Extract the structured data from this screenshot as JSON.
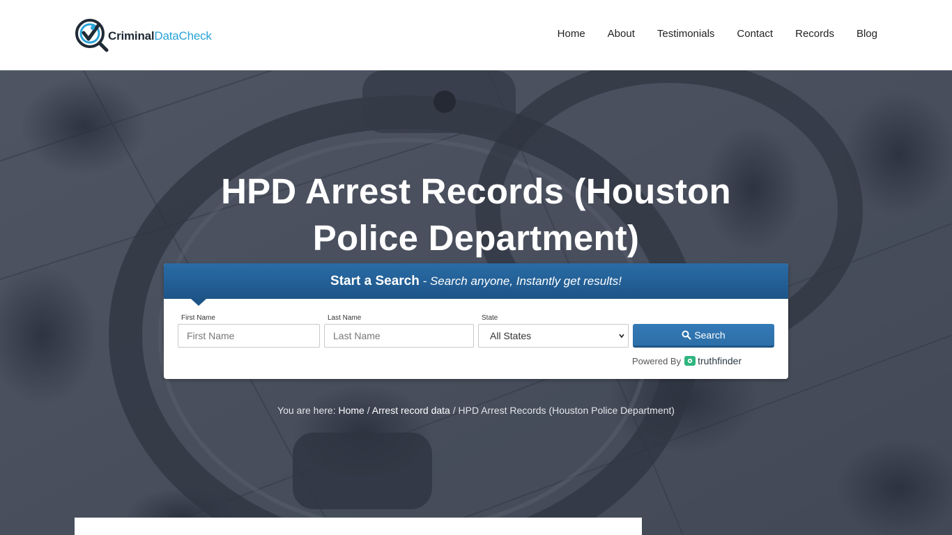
{
  "header": {
    "logo": {
      "bold": "Criminal",
      "light": "DataCheck"
    },
    "nav": [
      "Home",
      "About",
      "Testimonials",
      "Contact",
      "Records",
      "Blog"
    ]
  },
  "hero": {
    "title": "HPD Arrest Records (Houston Police Department)"
  },
  "search_widget": {
    "heading_strong": "Start a Search",
    "heading_em": " - Search anyone, Instantly get results!",
    "first_name": {
      "label": "First Name",
      "placeholder": "First Name"
    },
    "last_name": {
      "label": "Last Name",
      "placeholder": "Last Name"
    },
    "state": {
      "label": "State",
      "selected": "All States"
    },
    "button_label": "Search",
    "powered_by": "Powered By",
    "provider": "truthfinder"
  },
  "breadcrumb": {
    "prefix": "You are here:",
    "items": [
      "Home",
      "Arrest record data",
      "HPD Arrest Records (Houston Police Department)"
    ]
  },
  "colors": {
    "accent_blue": "#2aa3d8",
    "widget_header": "#1d5487",
    "button": "#337ab7"
  }
}
